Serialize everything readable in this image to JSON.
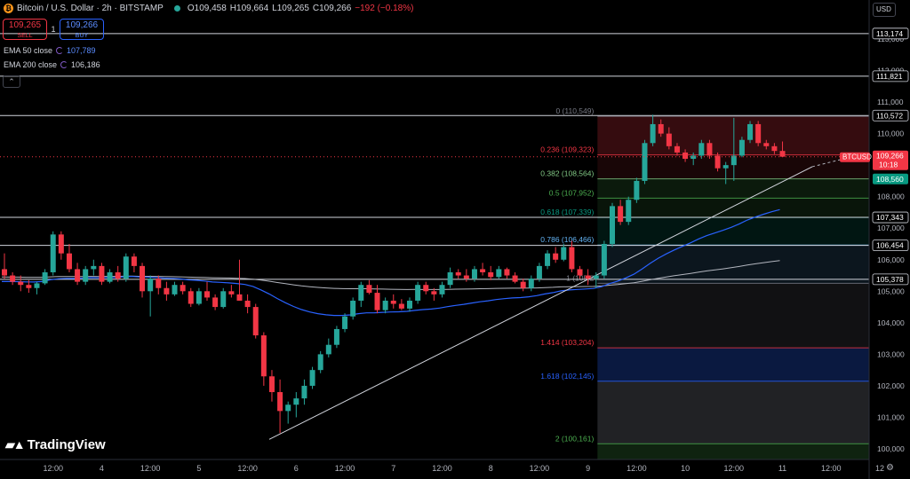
{
  "header": {
    "title": "Bitcoin / U.S. Dollar · 2h · BITSTAMP",
    "open": "O109,458",
    "high": "H109,664",
    "low": "L109,265",
    "close": "C109,266",
    "change": "−192 (−0.18%)"
  },
  "trade": {
    "sell_price": "109,265",
    "sell_label": "SELL",
    "quantity": "1",
    "buy_price": "109,266",
    "buy_label": "BUY"
  },
  "indicators": [
    {
      "label": "EMA 50 close",
      "value": "107,789",
      "color": "#2962ff"
    },
    {
      "label": "EMA 200 close",
      "value": "106,186",
      "color": "#d1d4dc"
    }
  ],
  "currency": "USD",
  "brand": "TradingView",
  "chart_data": {
    "type": "candlestick",
    "symbol_label": "BTCUSD",
    "price_axis": {
      "range": [
        99750,
        113350
      ],
      "ticks": [
        100000,
        101000,
        102000,
        103000,
        104000,
        105000,
        106000,
        107000,
        108000,
        109000,
        110000,
        111000,
        112000,
        113000
      ],
      "tick_labels": [
        "100,000",
        "101,000",
        "102,000",
        "103,000",
        "104,000",
        "105,000",
        "106,000",
        "107,000",
        "108,000",
        "109,000",
        "110,000",
        "111,000",
        "112,000",
        "113,000"
      ]
    },
    "time_axis": {
      "labels": [
        "12:00",
        "4",
        "12:00",
        "5",
        "12:00",
        "6",
        "12:00",
        "7",
        "12:00",
        "8",
        "12:00",
        "9",
        "12:00",
        "10",
        "12:00",
        "11",
        "12:00",
        "12"
      ],
      "bar_index": [
        6,
        12,
        18,
        24,
        30,
        36,
        42,
        48,
        54,
        60,
        66,
        72,
        78,
        84,
        90,
        96,
        102,
        108
      ]
    },
    "horizontal_levels": [
      {
        "price": 113174,
        "label": "113,174"
      },
      {
        "price": 111821,
        "label": "111,821"
      },
      {
        "price": 110572,
        "label": "110,572"
      },
      {
        "price": 107343,
        "label": "107,343"
      },
      {
        "price": 106454,
        "label": "106,454"
      },
      {
        "price": 105378,
        "label": "105,378"
      }
    ],
    "fibonacci": [
      {
        "ratio": "0",
        "price": 110549,
        "label": "0 (110,549)",
        "color": "#787b86"
      },
      {
        "ratio": "0.236",
        "price": 109323,
        "label": "0.236 (109,323)",
        "color": "#f23645"
      },
      {
        "ratio": "0.382",
        "price": 108564,
        "label": "0.382 (108,564)",
        "color": "#81c784"
      },
      {
        "ratio": "0.5",
        "price": 107952,
        "label": "0.5 (107,952)",
        "color": "#4caf50"
      },
      {
        "ratio": "0.618",
        "price": 107339,
        "label": "0.618 (107,339)",
        "color": "#089981"
      },
      {
        "ratio": "0.786",
        "price": 106466,
        "label": "0.786 (106,466)",
        "color": "#64b5f6"
      },
      {
        "ratio": "1",
        "price": 105250,
        "label": "1 (105,2",
        "color": "#787b86"
      },
      {
        "ratio": "1.414",
        "price": 103204,
        "label": "1.414 (103,204)",
        "color": "#f23645"
      },
      {
        "ratio": "1.618",
        "price": 102145,
        "label": "1.618 (102,145)",
        "color": "#2962ff"
      },
      {
        "ratio": "2",
        "price": 100161,
        "label": "2 (100,161)",
        "color": "#4caf50"
      }
    ],
    "fib_start_bar": 73.5,
    "last_price": {
      "value": 109266,
      "label": "109,266",
      "countdown": "10:18"
    },
    "green_price_tag": {
      "value": 108560,
      "label": "108,560"
    },
    "trendline_bars": [
      33,
      100
    ],
    "trendline_prices": [
      100300,
      108950
    ],
    "ema200_end": {
      "bar_span": [
        66,
        100
      ],
      "prices": [
        105250,
        106186
      ]
    },
    "candles": [
      [
        0,
        105700,
        106200,
        105400,
        105500
      ],
      [
        1,
        105500,
        105600,
        105200,
        105300
      ],
      [
        2,
        105300,
        105500,
        105000,
        105200
      ],
      [
        3,
        105200,
        105350,
        104950,
        105100
      ],
      [
        4,
        105100,
        105300,
        104900,
        105250
      ],
      [
        5,
        105250,
        105700,
        105200,
        105600
      ],
      [
        6,
        105600,
        106900,
        105500,
        106800
      ],
      [
        7,
        106800,
        106900,
        106000,
        106200
      ],
      [
        8,
        106200,
        106500,
        105600,
        105700
      ],
      [
        9,
        105700,
        105900,
        105200,
        105300
      ],
      [
        10,
        105300,
        105800,
        105200,
        105700
      ],
      [
        11,
        105700,
        106000,
        105500,
        105800
      ],
      [
        12,
        105800,
        105900,
        105200,
        105300
      ],
      [
        13,
        105300,
        105700,
        105250,
        105600
      ],
      [
        14,
        105600,
        105800,
        105300,
        105400
      ],
      [
        15,
        105400,
        106200,
        105300,
        106100
      ],
      [
        16,
        106100,
        106200,
        105600,
        105800
      ],
      [
        17,
        105800,
        105900,
        104800,
        105000
      ],
      [
        18,
        105000,
        105500,
        104200,
        105400
      ],
      [
        19,
        105400,
        105500,
        104900,
        105100
      ],
      [
        20,
        105100,
        105300,
        104700,
        104900
      ],
      [
        21,
        104900,
        105300,
        104850,
        105200
      ],
      [
        22,
        105200,
        105300,
        104900,
        105000
      ],
      [
        23,
        105000,
        105100,
        104500,
        104600
      ],
      [
        24,
        104600,
        105100,
        104550,
        105000
      ],
      [
        25,
        105000,
        105300,
        104700,
        104800
      ],
      [
        26,
        104800,
        104900,
        104400,
        104500
      ],
      [
        27,
        104500,
        105100,
        104450,
        105000
      ],
      [
        28,
        105000,
        105200,
        104800,
        104900
      ],
      [
        29,
        104900,
        106000,
        104700,
        104700
      ],
      [
        30,
        104700,
        104900,
        104300,
        104500
      ],
      [
        31,
        104500,
        104600,
        103500,
        103600
      ],
      [
        32,
        103600,
        103700,
        102000,
        102300
      ],
      [
        33,
        102300,
        102500,
        101500,
        101800
      ],
      [
        34,
        101800,
        102200,
        100500,
        101200
      ],
      [
        35,
        101200,
        101500,
        100800,
        101400
      ],
      [
        36,
        101400,
        101800,
        101000,
        101600
      ],
      [
        37,
        101600,
        102200,
        101400,
        102000
      ],
      [
        38,
        102000,
        102600,
        101900,
        102500
      ],
      [
        39,
        102500,
        103100,
        102400,
        103000
      ],
      [
        40,
        103000,
        103500,
        102900,
        103300
      ],
      [
        41,
        103300,
        103900,
        103200,
        103800
      ],
      [
        42,
        103800,
        104300,
        103700,
        104200
      ],
      [
        43,
        104200,
        104800,
        104100,
        104700
      ],
      [
        44,
        104700,
        105300,
        104500,
        105200
      ],
      [
        45,
        105200,
        105350,
        104900,
        104950
      ],
      [
        46,
        104950,
        105200,
        104300,
        104400
      ],
      [
        47,
        104400,
        104800,
        104300,
        104700
      ],
      [
        48,
        104700,
        104900,
        104450,
        104600
      ],
      [
        49,
        104600,
        104750,
        104400,
        104450
      ],
      [
        50,
        104450,
        104800,
        104350,
        104700
      ],
      [
        51,
        104700,
        105300,
        104600,
        105200
      ],
      [
        52,
        105200,
        105300,
        104900,
        105000
      ],
      [
        53,
        105000,
        105100,
        104700,
        104900
      ],
      [
        54,
        104900,
        105300,
        104800,
        105200
      ],
      [
        55,
        105200,
        105750,
        105100,
        105600
      ],
      [
        56,
        105600,
        105700,
        105400,
        105500
      ],
      [
        57,
        105500,
        105700,
        105300,
        105400
      ],
      [
        58,
        105400,
        105800,
        105300,
        105700
      ],
      [
        59,
        105700,
        105900,
        105500,
        105600
      ],
      [
        60,
        105600,
        105800,
        105350,
        105450
      ],
      [
        61,
        105450,
        105800,
        105400,
        105700
      ],
      [
        62,
        105700,
        105750,
        105400,
        105500
      ],
      [
        63,
        105500,
        105600,
        105250,
        105300
      ],
      [
        64,
        105300,
        105400,
        105000,
        105100
      ],
      [
        65,
        105100,
        105500,
        105000,
        105400
      ],
      [
        66,
        105400,
        105900,
        105300,
        105800
      ],
      [
        67,
        105800,
        106300,
        105700,
        106200
      ],
      [
        68,
        106200,
        106400,
        105900,
        106000
      ],
      [
        69,
        106000,
        106500,
        105950,
        106400
      ],
      [
        70,
        106400,
        106600,
        105600,
        105700
      ],
      [
        71,
        105700,
        105800,
        105400,
        105500
      ],
      [
        72,
        105500,
        105700,
        105200,
        105400
      ],
      [
        73,
        105400,
        105600,
        105100,
        105500
      ],
      [
        74,
        105500,
        106600,
        105400,
        106500
      ],
      [
        75,
        106500,
        107800,
        106400,
        107700
      ],
      [
        76,
        107700,
        107900,
        107100,
        107200
      ],
      [
        77,
        107200,
        108000,
        107100,
        107900
      ],
      [
        78,
        107900,
        108600,
        107800,
        108500
      ],
      [
        79,
        108500,
        109800,
        108400,
        109700
      ],
      [
        80,
        109700,
        110600,
        109600,
        110300
      ],
      [
        81,
        110300,
        110450,
        109900,
        110000
      ],
      [
        82,
        110000,
        110200,
        109500,
        109600
      ],
      [
        83,
        109600,
        109700,
        109300,
        109400
      ],
      [
        84,
        109400,
        109500,
        109100,
        109200
      ],
      [
        85,
        109200,
        109400,
        109000,
        109300
      ],
      [
        86,
        109300,
        109800,
        109200,
        109700
      ],
      [
        87,
        109700,
        109800,
        109200,
        109300
      ],
      [
        88,
        109300,
        109400,
        108800,
        108900
      ],
      [
        89,
        108900,
        109100,
        108400,
        109000
      ],
      [
        90,
        109000,
        110500,
        108500,
        109300
      ],
      [
        91,
        109300,
        109900,
        109250,
        109800
      ],
      [
        92,
        109800,
        110400,
        109700,
        110300
      ],
      [
        93,
        110300,
        110400,
        109600,
        109700
      ],
      [
        94,
        109700,
        109800,
        109500,
        109600
      ],
      [
        95,
        109600,
        109700,
        109350,
        109450
      ],
      [
        96,
        109450,
        109750,
        109300,
        109266
      ]
    ]
  }
}
